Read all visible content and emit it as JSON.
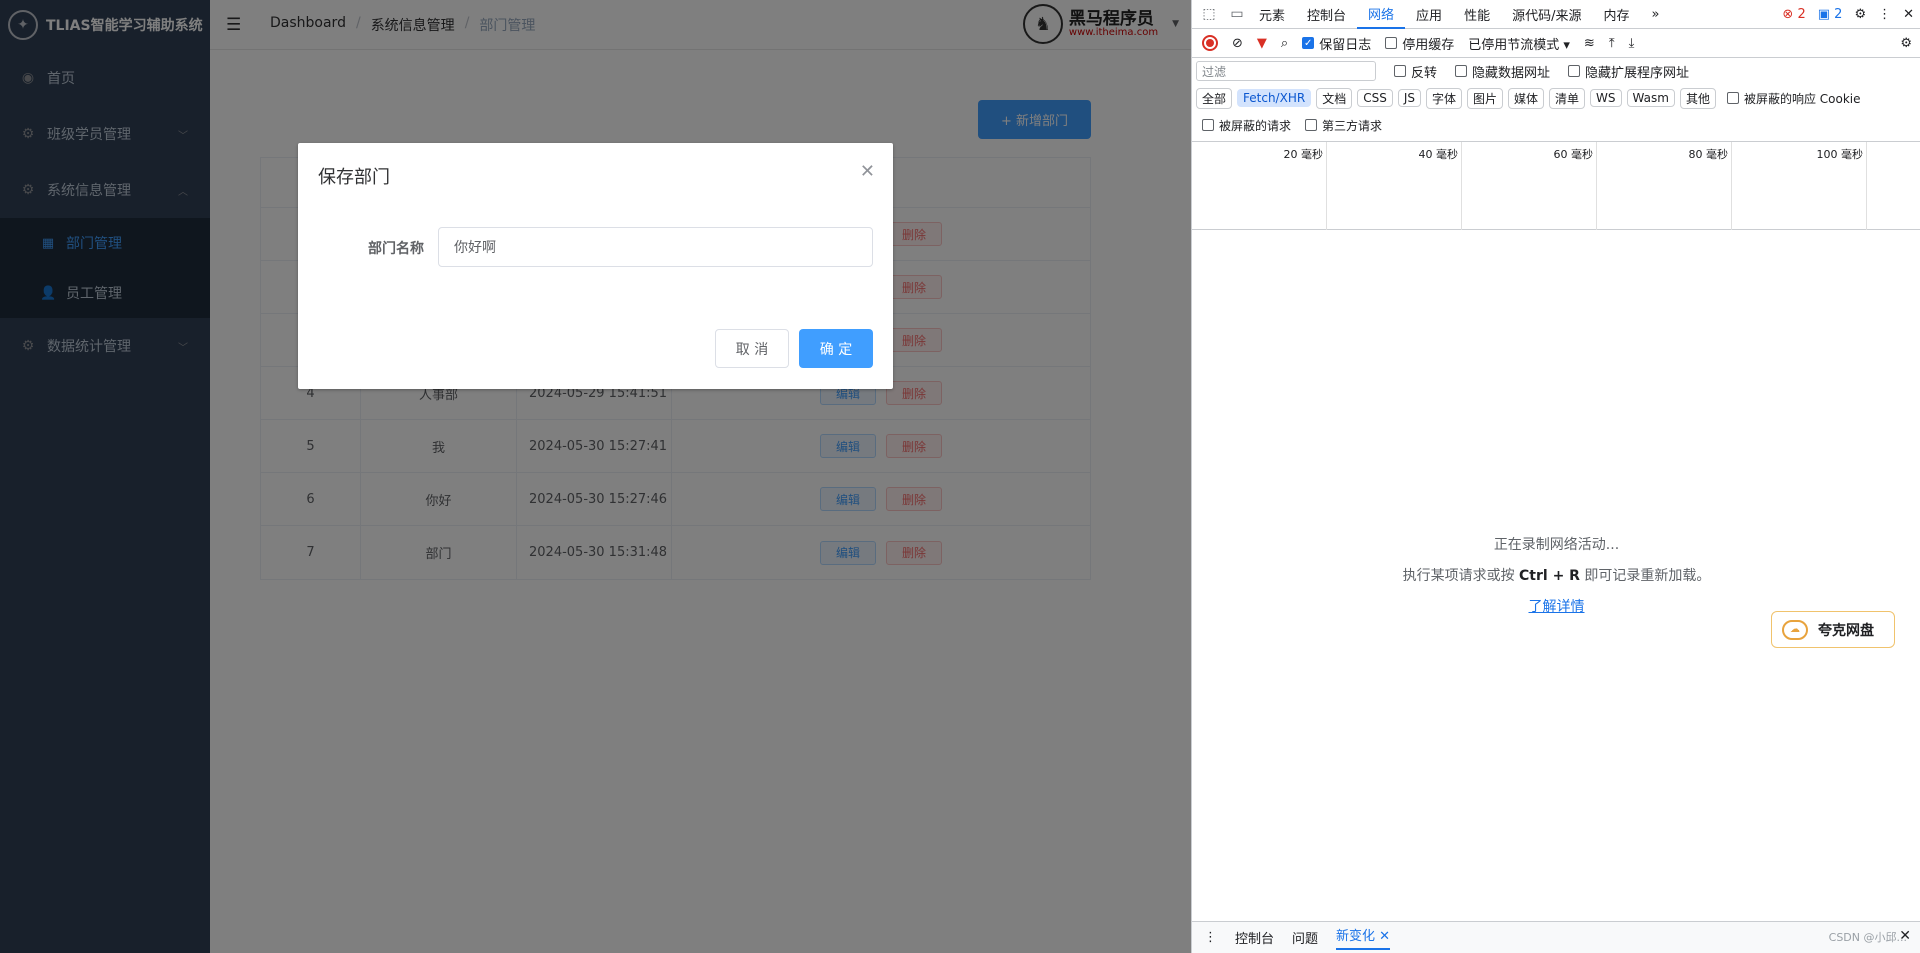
{
  "sidebar": {
    "title": "TLIAS智能学习辅助系统",
    "items": [
      {
        "label": "首页"
      },
      {
        "label": "班级学员管理"
      },
      {
        "label": "系统信息管理"
      },
      {
        "label": "数据统计管理"
      }
    ],
    "sub_items": [
      {
        "label": "部门管理"
      },
      {
        "label": "员工管理"
      }
    ]
  },
  "navbar": {
    "breadcrumb": [
      "Dashboard",
      "系统信息管理",
      "部门管理"
    ],
    "brand_name": "黑马程序员",
    "brand_url": "www.itheima.com"
  },
  "main": {
    "add_button": "+ 新增部门",
    "rows": [
      {
        "id": "4",
        "name": "人事部",
        "time": "2024-05-29 15:41:51"
      },
      {
        "id": "5",
        "name": "我",
        "time": "2024-05-30 15:27:41"
      },
      {
        "id": "6",
        "name": "你好",
        "time": "2024-05-30 15:27:46"
      },
      {
        "id": "7",
        "name": "部门",
        "time": "2024-05-30 15:31:48"
      }
    ],
    "edit_label": "编辑",
    "delete_label": "删除"
  },
  "dialog": {
    "title": "保存部门",
    "field_label": "部门名称",
    "field_value": "你好啊",
    "cancel": "取 消",
    "ok": "确 定"
  },
  "devtools": {
    "tabs": [
      "元素",
      "控制台",
      "网络",
      "应用",
      "性能",
      "源代码/来源",
      "内存"
    ],
    "error_count": "2",
    "message_count": "2",
    "toolbar": {
      "preserve_log": "保留日志",
      "disable_cache": "停用缓存",
      "throttle": "已停用节流模式"
    },
    "filter_placeholder": "过滤",
    "filter_options": [
      "反转",
      "隐藏数据网址",
      "隐藏扩展程序网址"
    ],
    "chips": [
      "全部",
      "Fetch/XHR",
      "文档",
      "CSS",
      "JS",
      "字体",
      "图片",
      "媒体",
      "清单",
      "WS",
      "Wasm",
      "其他"
    ],
    "blocked_cookie": "被屏蔽的响应 Cookie",
    "blocked_requests": "被屏蔽的请求",
    "third_party": "第三方请求",
    "timeline_labels": [
      "20 毫秒",
      "40 毫秒",
      "60 毫秒",
      "80 毫秒",
      "100 毫秒"
    ],
    "empty_line1": "正在录制网络活动...",
    "empty_line2_a": "执行某项请求或按 ",
    "empty_line2_key": "Ctrl + R",
    "empty_line2_b": " 即可记录重新加载。",
    "learn_more": "了解详情",
    "bottom_tabs": [
      "控制台",
      "问题",
      "新变化"
    ],
    "quark": "夸克网盘",
    "watermark": "CSDN @小邱..."
  }
}
